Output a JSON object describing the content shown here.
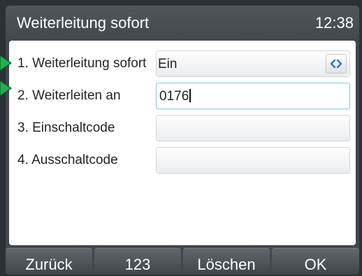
{
  "header": {
    "title": "Weiterleitung sofort",
    "time": "12:38"
  },
  "rows": [
    {
      "label": "1. Weiterleitung sofort",
      "value": "Ein"
    },
    {
      "label": "2. Weiterleiten an",
      "value": "0176"
    },
    {
      "label": "3. Einschaltcode",
      "value": ""
    },
    {
      "label": "4. Ausschaltcode",
      "value": ""
    }
  ],
  "softkeys": [
    "Zurück",
    "123",
    "Löschen",
    "OK"
  ],
  "icons": {
    "selector": "left-right-arrows-icon",
    "pointer": "green-arrow-icon"
  },
  "colors": {
    "accent": "#7ec7d8",
    "pointer": "#23b14d",
    "selector": "#2f6fd0"
  }
}
